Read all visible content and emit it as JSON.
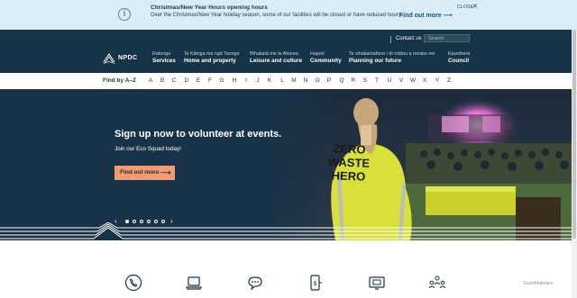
{
  "alert": {
    "title": "Christmas/New Year Hours opening hours",
    "text": "Over the Christmas/New Year holiday season, some of our facilities will be closed or have reduced hours.",
    "link_label": "Find out more",
    "link_arrow": "⟶",
    "close_label": "CLOSE",
    "close_symbol": "✕",
    "info_symbol": "i"
  },
  "header": {
    "contact_label": "Contact us",
    "search_placeholder": "Search",
    "logo_text": "NPDC"
  },
  "nav": [
    {
      "sub": "Ratonga",
      "main": "Services"
    },
    {
      "sub": "Te Kāinga me ngā Taonga",
      "main": "Home and property"
    },
    {
      "sub": "Whakatā me te Ahurea",
      "main": "Leisure and culture"
    },
    {
      "sub": "Hapori",
      "main": "Community"
    },
    {
      "sub": "Te whakamahere i tō mātou a meake nei",
      "main": "Planning our future"
    },
    {
      "sub": "Kaunihera",
      "main": "Council"
    }
  ],
  "az": {
    "label": "Find by A–Z",
    "letters": [
      "A",
      "B",
      "C",
      "D",
      "E",
      "F",
      "G",
      "H",
      "I",
      "J",
      "K",
      "L",
      "M",
      "N",
      "O",
      "P",
      "Q",
      "R",
      "S",
      "T",
      "U",
      "V",
      "W",
      "X",
      "Y",
      "Z"
    ]
  },
  "hero": {
    "title": "Sign up now to volunteer at events.",
    "subtitle": "Join our Eco Squad today!",
    "button_label": "Find out more",
    "button_arrow": "⟶",
    "vest_line1": "ZERO",
    "vest_line2": "WASTE",
    "vest_line3": "HERO",
    "slider_prev": "‹",
    "slider_next": "›",
    "slide_count": 6,
    "active_slide": 1
  },
  "quick_icons": [
    "phone-icon",
    "laptop-icon",
    "chat-icon",
    "mobile-pay-icon",
    "screen-payment-icon",
    "community-icon"
  ],
  "watermark": "ScanMalware",
  "colors": {
    "navy": "#163447",
    "accent_orange": "#f29b71",
    "alert_bg": "#d9edf7",
    "vest_yellow": "#d9e03a"
  }
}
